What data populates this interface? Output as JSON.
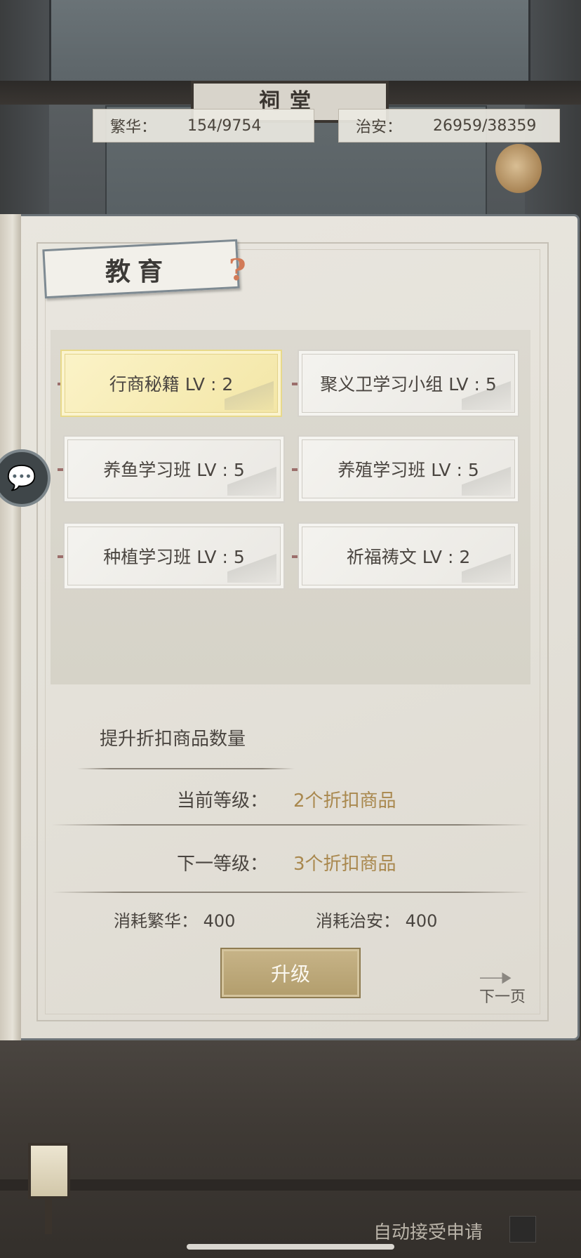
{
  "scene": {
    "plaque_text": "祠堂"
  },
  "stats": {
    "prosperity": {
      "label": "繁华：",
      "value": "154/9754"
    },
    "security": {
      "label": "治安：",
      "value": "26959/38359"
    }
  },
  "panel": {
    "title": "教育",
    "help_glyph": "?",
    "chat_glyph": "💬"
  },
  "courses": [
    {
      "label": "行商秘籍 LV : 2",
      "selected": true
    },
    {
      "label": "聚义卫学习小组 LV : 5",
      "selected": false
    },
    {
      "label": "养鱼学习班 LV : 5",
      "selected": false
    },
    {
      "label": "养殖学习班 LV : 5",
      "selected": false
    },
    {
      "label": "种植学习班 LV : 5",
      "selected": false
    },
    {
      "label": "祈福祷文 LV : 2",
      "selected": false
    }
  ],
  "detail": {
    "description": "提升折扣商品数量",
    "current_label": "当前等级：",
    "current_value": "2个折扣商品",
    "next_label": "下一等级：",
    "next_value": "3个折扣商品",
    "cost_prosperity": "消耗繁华： 400",
    "cost_security": "消耗治安： 400",
    "upgrade_label": "升级",
    "next_page_label": "下一页"
  },
  "footer": {
    "auto_accept_label": "自动接受申请"
  },
  "colors": {
    "accent_gold": "#a9884e",
    "button_gold": "#b29d6c",
    "selected_yellow": "#f3e6a6"
  }
}
